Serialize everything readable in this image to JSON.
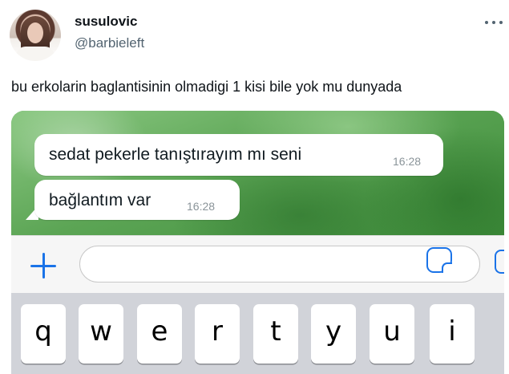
{
  "tweet": {
    "display_name": "susulovic",
    "handle": "@barbieleft",
    "text": "bu erkolarin baglantisinin olmadigi 1 kisi bile yok mu dunyada",
    "more_icon": "more-horizontal-icon"
  },
  "chat": {
    "messages": [
      {
        "text": "sedat pekerle tanıştırayım mı seni",
        "time": "16:28"
      },
      {
        "text": "bağlantım var",
        "time": "16:28"
      }
    ],
    "input_placeholder": "",
    "icons": [
      "plus-icon",
      "sticker-icon",
      "camera-icon"
    ]
  },
  "keyboard": {
    "keys": [
      "q",
      "w",
      "e",
      "r",
      "t",
      "y",
      "u",
      "i"
    ]
  },
  "colors": {
    "accent": "#1a73e8",
    "chat_background": "#5fa85a",
    "keyboard_background": "#d1d3d9"
  }
}
